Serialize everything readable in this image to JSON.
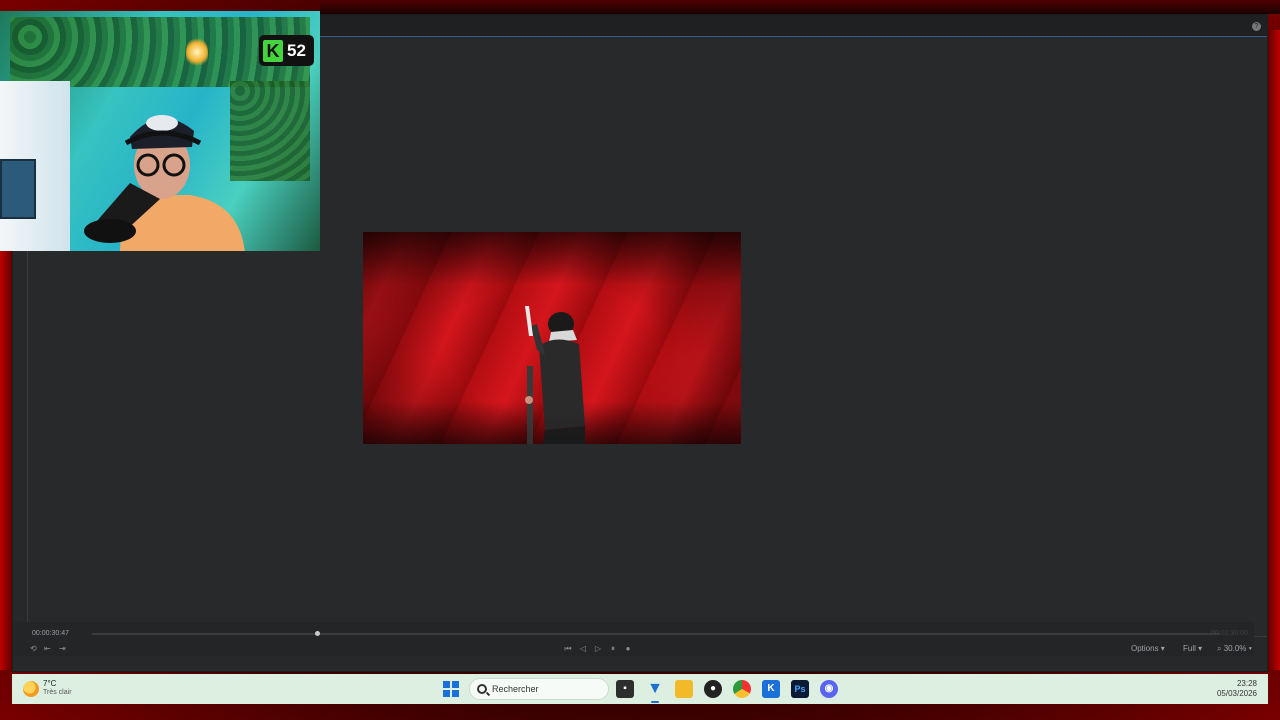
{
  "webcam": {
    "badge_letter": "K",
    "badge_count": "52"
  },
  "editor": {
    "help_icon": "?"
  },
  "timeline": {
    "current_timecode": "00:00:30:47",
    "total_timecode": "00:02:30:00",
    "playhead_progress": 0.2
  },
  "transport": {
    "controls": [
      "skip-back",
      "step-back",
      "step-forward",
      "pause",
      "stop"
    ]
  },
  "viewer_options": {
    "options_label": "Options",
    "quality_label": "Full",
    "zoom_label": "30.0%"
  },
  "taskbar": {
    "weather_temp": "7°C",
    "weather_desc": "Très clair",
    "search_placeholder": "Rechercher",
    "apps": [
      "file-explorer",
      "vsts-app",
      "folder",
      "media-app",
      "chrome",
      "kick-app",
      "photoshop",
      "discord"
    ],
    "time": "23:28",
    "date": "05/03/2026"
  },
  "colors": {
    "accent_blue": "#3a5a8a",
    "frame_red": "#c00000",
    "kick_green": "#43d63c"
  }
}
